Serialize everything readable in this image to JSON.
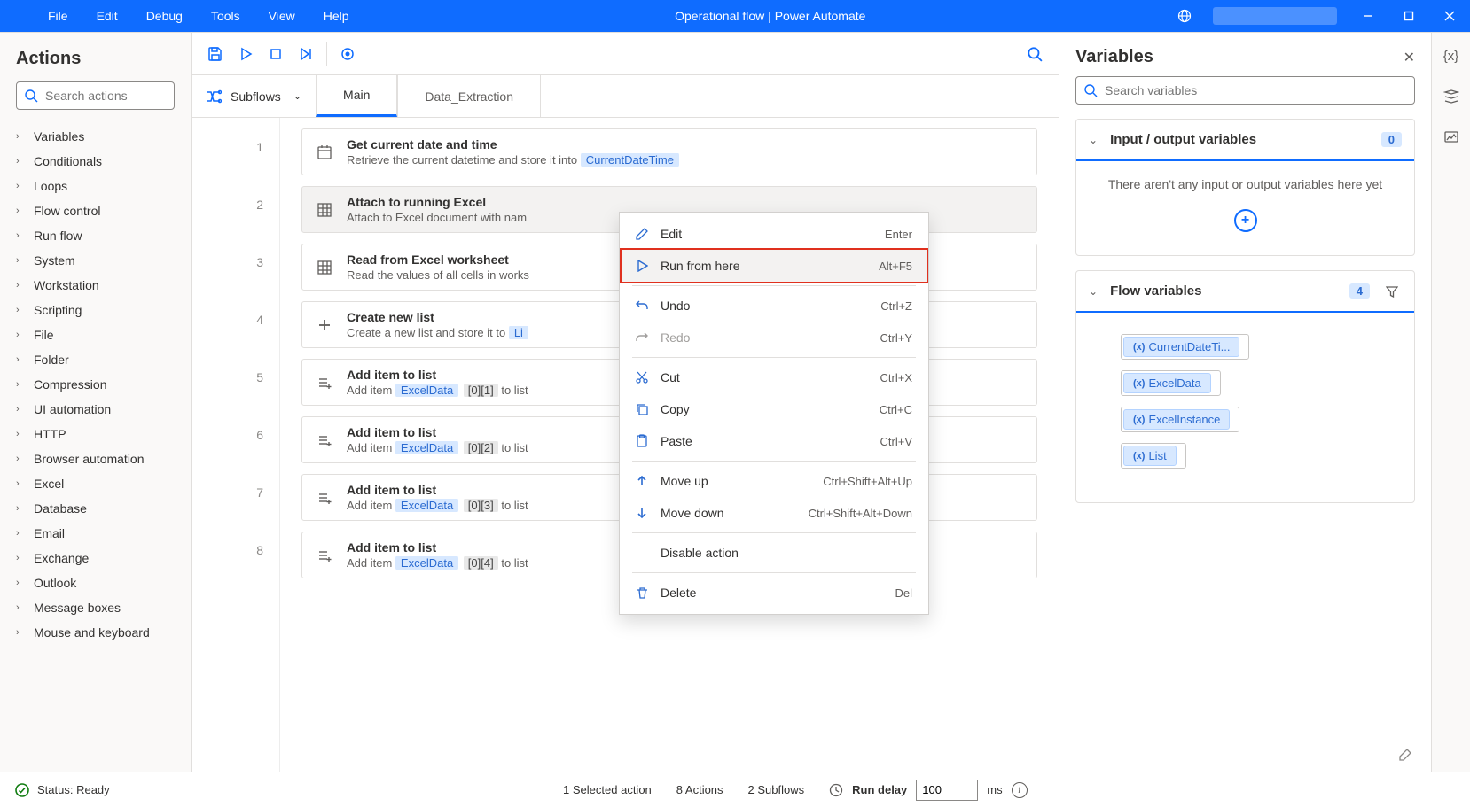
{
  "menubar": [
    "File",
    "Edit",
    "Debug",
    "Tools",
    "View",
    "Help"
  ],
  "window_title": "Operational flow | Power Automate",
  "actions_panel": {
    "title": "Actions",
    "search_placeholder": "Search actions",
    "categories": [
      "Variables",
      "Conditionals",
      "Loops",
      "Flow control",
      "Run flow",
      "System",
      "Workstation",
      "Scripting",
      "File",
      "Folder",
      "Compression",
      "UI automation",
      "HTTP",
      "Browser automation",
      "Excel",
      "Database",
      "Email",
      "Exchange",
      "Outlook",
      "Message boxes",
      "Mouse and keyboard"
    ]
  },
  "subflows": {
    "label": "Subflows",
    "tabs": [
      "Main",
      "Data_Extraction"
    ],
    "active": 0
  },
  "steps": [
    {
      "n": 1,
      "title": "Get current date and time",
      "desc_prefix": "Retrieve the current datetime and store it into ",
      "token": "CurrentDateTime"
    },
    {
      "n": 2,
      "title": "Attach to running Excel",
      "desc_prefix": "Attach to Excel document with nam",
      "selected": true
    },
    {
      "n": 3,
      "title": "Read from Excel worksheet",
      "desc_prefix": "Read the values of all cells in works"
    },
    {
      "n": 4,
      "title": "Create new list",
      "desc_prefix": "Create a new list and store it to  ",
      "token": "Li"
    },
    {
      "n": 5,
      "title": "Add item to list",
      "desc_prefix": "Add item  ",
      "token": "ExcelData",
      "idx": "[0][1]",
      "suffix": " to list"
    },
    {
      "n": 6,
      "title": "Add item to list",
      "desc_prefix": "Add item  ",
      "token": "ExcelData",
      "idx": "[0][2]",
      "suffix": " to list"
    },
    {
      "n": 7,
      "title": "Add item to list",
      "desc_prefix": "Add item  ",
      "token": "ExcelData",
      "idx": "[0][3]",
      "suffix": " to list"
    },
    {
      "n": 8,
      "title": "Add item to list",
      "desc_prefix": "Add item  ",
      "token": "ExcelData",
      "idx": "[0][4]",
      "suffix": " to list"
    }
  ],
  "context_menu": [
    {
      "label": "Edit",
      "shortcut": "Enter",
      "icon": "edit"
    },
    {
      "label": "Run from here",
      "shortcut": "Alt+F5",
      "icon": "play",
      "highlighted": true
    },
    {
      "sep": true
    },
    {
      "label": "Undo",
      "shortcut": "Ctrl+Z",
      "icon": "undo"
    },
    {
      "label": "Redo",
      "shortcut": "Ctrl+Y",
      "icon": "redo",
      "disabled": true
    },
    {
      "sep": true
    },
    {
      "label": "Cut",
      "shortcut": "Ctrl+X",
      "icon": "cut"
    },
    {
      "label": "Copy",
      "shortcut": "Ctrl+C",
      "icon": "copy"
    },
    {
      "label": "Paste",
      "shortcut": "Ctrl+V",
      "icon": "paste"
    },
    {
      "sep": true
    },
    {
      "label": "Move up",
      "shortcut": "Ctrl+Shift+Alt+Up",
      "icon": "up"
    },
    {
      "label": "Move down",
      "shortcut": "Ctrl+Shift+Alt+Down",
      "icon": "down"
    },
    {
      "sep": true
    },
    {
      "label": "Disable action",
      "shortcut": "",
      "icon": ""
    },
    {
      "sep": true
    },
    {
      "label": "Delete",
      "shortcut": "Del",
      "icon": "trash"
    }
  ],
  "variables_panel": {
    "title": "Variables",
    "search_placeholder": "Search variables",
    "io_section": {
      "title": "Input / output variables",
      "count": "0",
      "empty_text": "There aren't any input or output variables here yet"
    },
    "flow_section": {
      "title": "Flow variables",
      "count": "4",
      "vars": [
        "CurrentDateTi...",
        "ExcelData",
        "ExcelInstance",
        "List"
      ]
    }
  },
  "statusbar": {
    "status": "Status: Ready",
    "selected": "1 Selected action",
    "actions": "8 Actions",
    "subflows": "2 Subflows",
    "delay_label": "Run delay",
    "delay_value": "100",
    "delay_unit": "ms"
  }
}
